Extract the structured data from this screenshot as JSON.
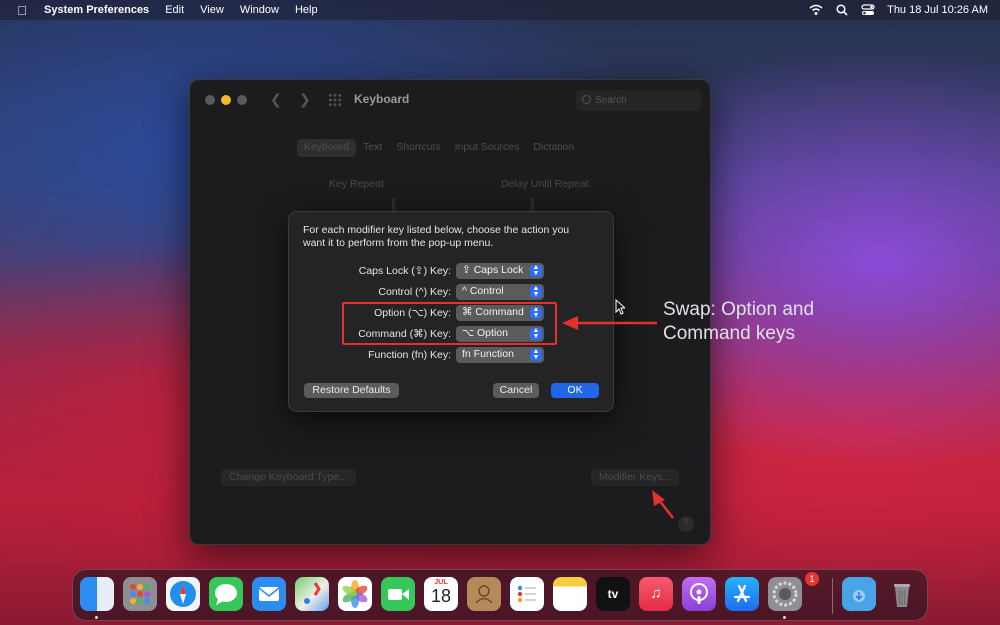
{
  "menubar": {
    "app_name": "System Preferences",
    "items": [
      "Edit",
      "View",
      "Window",
      "Help"
    ],
    "clock": "Thu 18 Jul  10:26 AM"
  },
  "window": {
    "title": "Keyboard",
    "search_placeholder": "Search",
    "tabs": [
      "Keyboard",
      "Text",
      "Shortcuts",
      "Input Sources",
      "Dictation"
    ],
    "selected_tab": "Keyboard",
    "key_repeat_label": "Key Repeat",
    "delay_label": "Delay Until Repeat",
    "change_keyboard_type": "Change Keyboard Type...",
    "modifier_keys": "Modifier Keys...",
    "help": "?"
  },
  "dialog": {
    "message": "For each modifier key listed below, choose the action you want it to perform from the pop-up menu.",
    "rows": [
      {
        "label": "Caps Lock (⇪) Key:",
        "value": "⇪ Caps Lock"
      },
      {
        "label": "Control (^) Key:",
        "value": "^ Control"
      },
      {
        "label": "Option (⌥) Key:",
        "value": "⌘ Command"
      },
      {
        "label": "Command (⌘) Key:",
        "value": "⌥ Option"
      },
      {
        "label": "Function (fn) Key:",
        "value": "fn Function"
      }
    ],
    "restore_defaults": "Restore Defaults",
    "cancel": "Cancel",
    "ok": "OK"
  },
  "annotation": {
    "text": "Swap: Option and Command keys",
    "color": "#e5302c"
  },
  "dock": {
    "calendar_month": "JUL",
    "calendar_day": "18",
    "tv_label": "tv",
    "settings_badge": "1"
  }
}
